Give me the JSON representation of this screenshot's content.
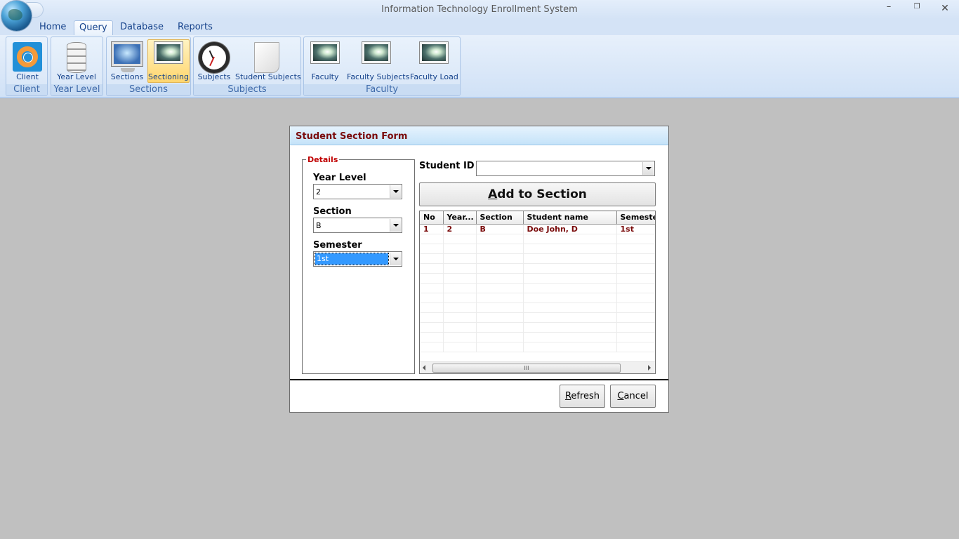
{
  "window": {
    "title": "Information Technology Enrollment System",
    "controls": {
      "minimize": "–",
      "maximize": "❐",
      "close": "✕"
    }
  },
  "ribbon": {
    "tabs": [
      {
        "label": "Home",
        "active": false
      },
      {
        "label": "Query",
        "active": true
      },
      {
        "label": "Database",
        "active": false
      },
      {
        "label": "Reports",
        "active": false
      }
    ],
    "groups": [
      {
        "label": "Client",
        "buttons": [
          {
            "label": "Client",
            "icon": "lifebuoy-icon"
          }
        ]
      },
      {
        "label": "Year Level",
        "buttons": [
          {
            "label": "Year Level",
            "icon": "database-icon"
          }
        ]
      },
      {
        "label": "Sections",
        "buttons": [
          {
            "label": "Sections",
            "icon": "monitor-icon"
          },
          {
            "label": "Sectioning",
            "icon": "image-icon",
            "selected": true
          }
        ]
      },
      {
        "label": "Subjects",
        "buttons": [
          {
            "label": "Subjects",
            "icon": "clock-icon"
          },
          {
            "label": "Student Subjects",
            "icon": "document-icon"
          }
        ]
      },
      {
        "label": "Faculty",
        "buttons": [
          {
            "label": "Faculty",
            "icon": "image-icon"
          },
          {
            "label": "Faculty Subjects",
            "icon": "image-icon"
          },
          {
            "label": "Faculty Load",
            "icon": "image-icon"
          }
        ]
      }
    ]
  },
  "dialog": {
    "title": "Student Section Form",
    "details_legend": "Details",
    "year_level": {
      "label": "Year Level",
      "value": "2"
    },
    "section": {
      "label": "Section",
      "value": "B"
    },
    "semester": {
      "label": "Semester",
      "value": "1st"
    },
    "student_id": {
      "label": "Student ID",
      "value": ""
    },
    "add_button": {
      "accel": "A",
      "rest": "dd to Section"
    },
    "grid": {
      "columns": [
        "No",
        "Year...",
        "Section",
        "Student name",
        "Semeste"
      ],
      "rows": [
        [
          "1",
          "2",
          "B",
          "Doe John, D",
          "1st"
        ]
      ],
      "scroll_thumb": "III"
    },
    "refresh_button": {
      "accel": "R",
      "rest": "efresh"
    },
    "cancel_button": {
      "accel": "C",
      "rest": "ancel"
    }
  },
  "colors": {
    "accent_text": "#7a0b0b",
    "legend": "#c00000",
    "selection": "#3399ff",
    "ribbon_text": "#15428b"
  }
}
